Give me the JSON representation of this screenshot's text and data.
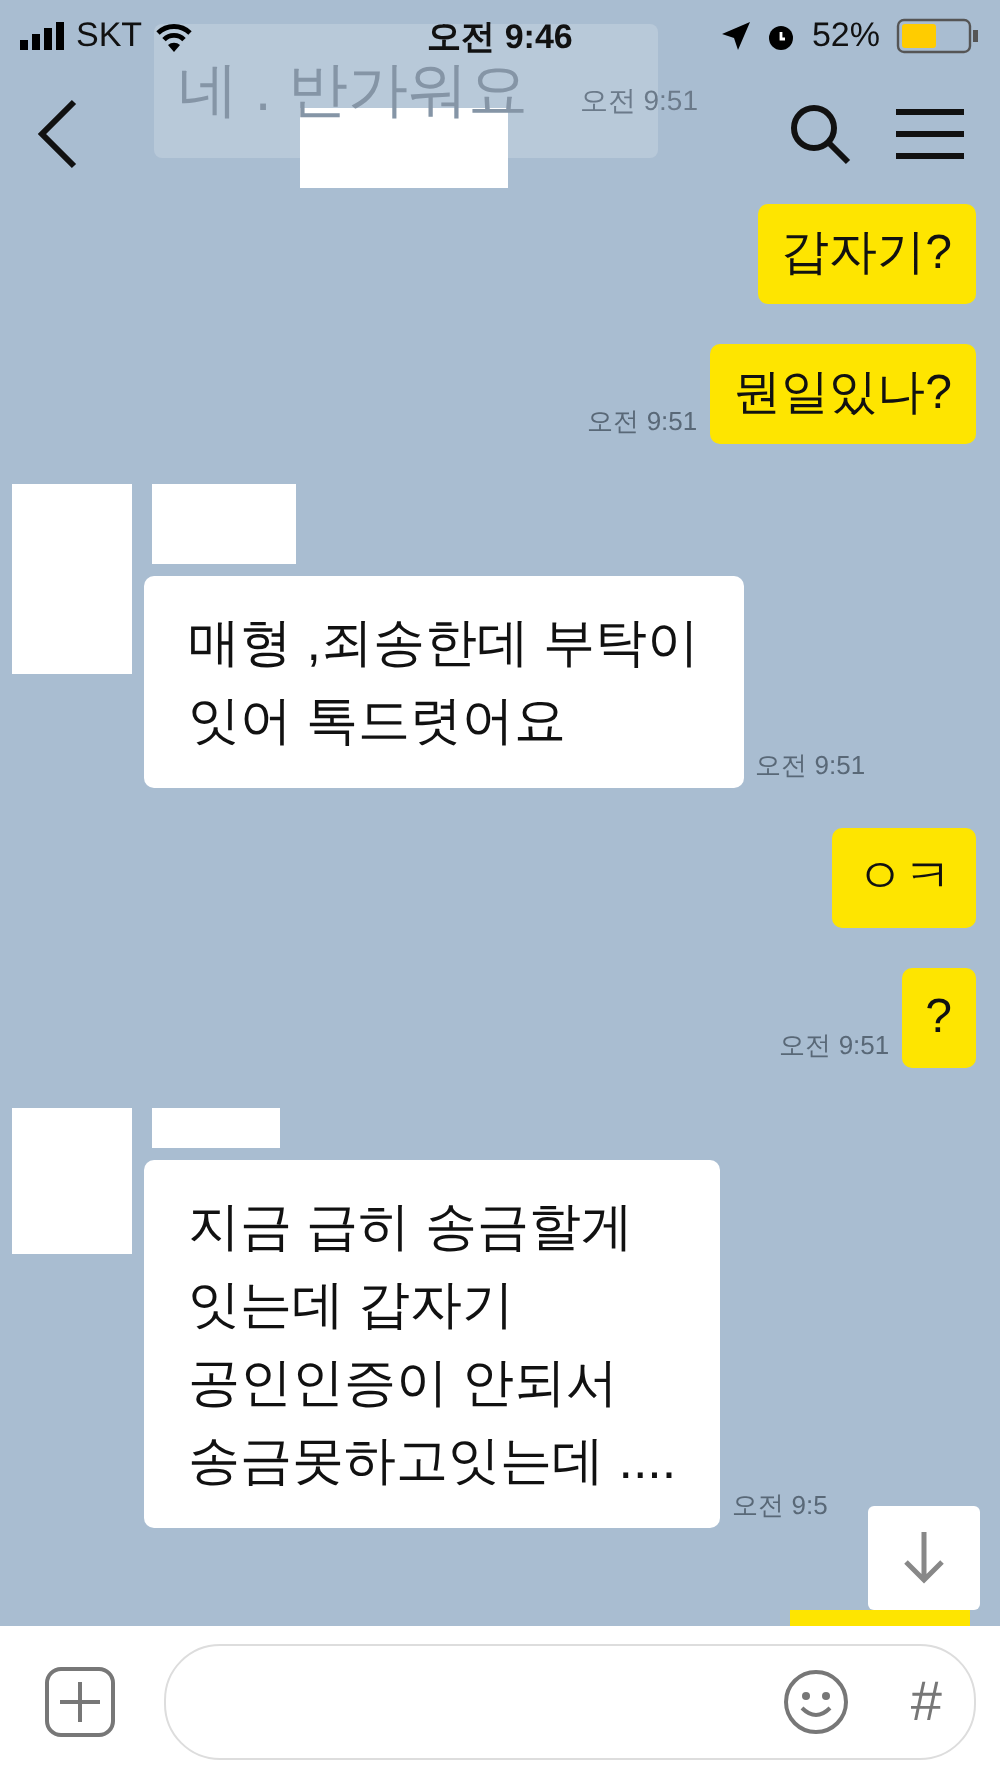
{
  "status_bar": {
    "carrier": "SKT",
    "time": "오전 9:46",
    "battery": "52%"
  },
  "header": {
    "overlay": {
      "text": "네 . 반가워요",
      "time": "오전 9:51"
    }
  },
  "messages": [
    {
      "kind": "outgoing",
      "text": "갑자기?"
    },
    {
      "kind": "outgoing",
      "text": "뭔일있나?",
      "time": "오전 9:51"
    },
    {
      "kind": "incoming",
      "text": "매형 ,죄송한데 부탁이\n잇어 톡드렷어요",
      "time": "오전 9:51"
    },
    {
      "kind": "outgoing",
      "text": "ㅇㅋ"
    },
    {
      "kind": "outgoing",
      "text": "?",
      "time": "오전 9:51"
    },
    {
      "kind": "incoming",
      "text": "지금 급히 송금할게\n잇는데 갑자기\n공인인증이 안되서\n송금못하고잇는데 ....",
      "time": "오전 9:5"
    }
  ],
  "input_bar": {
    "hash": "#"
  }
}
